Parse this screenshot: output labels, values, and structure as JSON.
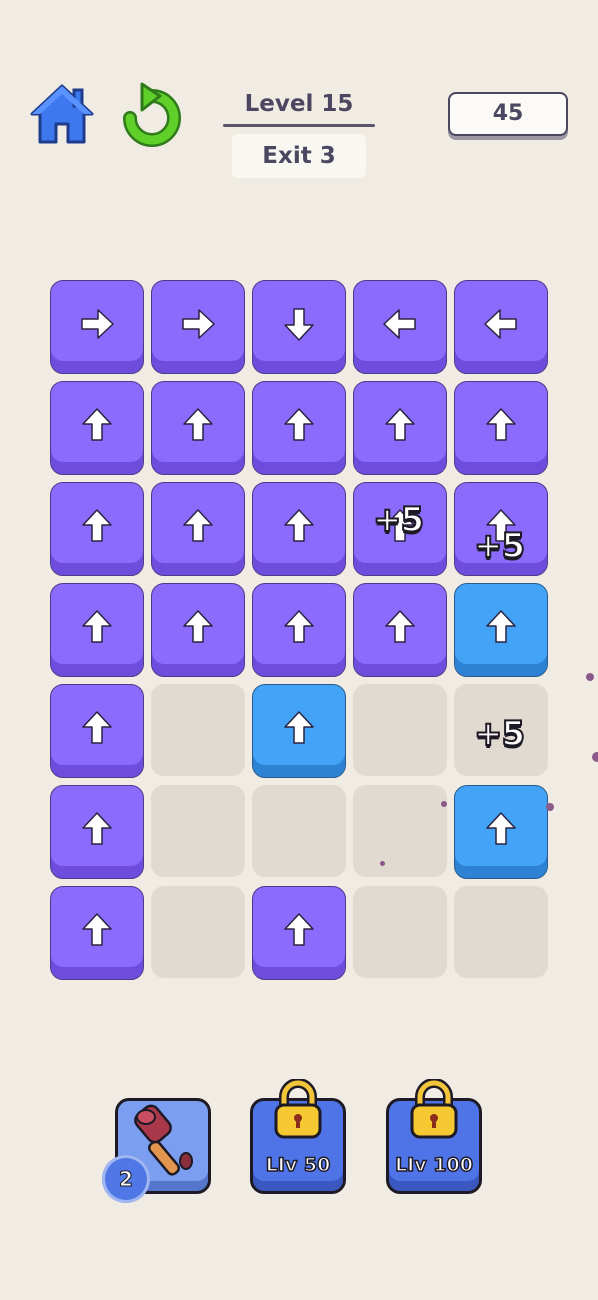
{
  "hud": {
    "home_icon": "home-icon",
    "restart_icon": "restart-icon",
    "level_label": "Level 15",
    "exit_label": "Exit 3",
    "moves_remaining": "45"
  },
  "board": {
    "rows": 7,
    "cols": 5,
    "cells": [
      [
        {
          "color": "purple",
          "arrow": "right"
        },
        {
          "color": "purple",
          "arrow": "right"
        },
        {
          "color": "purple",
          "arrow": "down"
        },
        {
          "color": "purple",
          "arrow": "left"
        },
        {
          "color": "purple",
          "arrow": "left"
        }
      ],
      [
        {
          "color": "purple",
          "arrow": "up"
        },
        {
          "color": "purple",
          "arrow": "up"
        },
        {
          "color": "purple",
          "arrow": "up"
        },
        {
          "color": "purple",
          "arrow": "up"
        },
        {
          "color": "purple",
          "arrow": "up"
        }
      ],
      [
        {
          "color": "purple",
          "arrow": "up"
        },
        {
          "color": "purple",
          "arrow": "up"
        },
        {
          "color": "purple",
          "arrow": "up"
        },
        {
          "color": "purple",
          "arrow": "up"
        },
        {
          "color": "purple",
          "arrow": "up"
        }
      ],
      [
        {
          "color": "purple",
          "arrow": "up"
        },
        {
          "color": "purple",
          "arrow": "up"
        },
        {
          "color": "purple",
          "arrow": "up"
        },
        {
          "color": "purple",
          "arrow": "up"
        },
        {
          "color": "blue",
          "arrow": "up"
        }
      ],
      [
        {
          "color": "purple",
          "arrow": "up"
        },
        {
          "color": "empty"
        },
        {
          "color": "blue",
          "arrow": "up"
        },
        {
          "color": "empty"
        },
        {
          "color": "empty"
        }
      ],
      [
        {
          "color": "purple",
          "arrow": "up"
        },
        {
          "color": "empty"
        },
        {
          "color": "empty"
        },
        {
          "color": "empty"
        },
        {
          "color": "blue",
          "arrow": "up"
        }
      ],
      [
        {
          "color": "purple",
          "arrow": "up"
        },
        {
          "color": "empty"
        },
        {
          "color": "purple",
          "arrow": "up"
        },
        {
          "color": "empty"
        },
        {
          "color": "empty"
        }
      ]
    ],
    "bonus_popups": [
      {
        "text": "+5",
        "row": 2,
        "col": 3
      },
      {
        "text": "+5",
        "row": 2,
        "col": 4
      },
      {
        "text": "+5",
        "row": 4,
        "col": 4
      }
    ]
  },
  "tools": [
    {
      "name": "hammer",
      "icon": "hammer-icon",
      "count": "2",
      "locked": false
    },
    {
      "name": "lock-50",
      "icon": "lock-icon",
      "label": "LIv 50",
      "locked": true
    },
    {
      "name": "lock-100",
      "icon": "lock-icon",
      "label": "LIv 100",
      "locked": true
    }
  ],
  "colors": {
    "background": "#f1ece3",
    "tile_purple": "#8a6bfb",
    "tile_blue": "#43a4f7",
    "tile_empty": "#e0dad0",
    "home_blue": "#3d78ee",
    "restart_green": "#5fcf2a"
  }
}
